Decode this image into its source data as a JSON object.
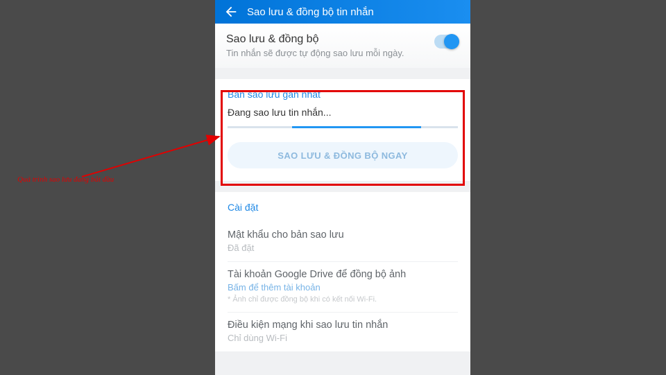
{
  "appbar": {
    "title": "Sao lưu & đồng bộ tin nhắn"
  },
  "sync_card": {
    "title": "Sao lưu & đồng bộ",
    "subtitle": "Tin nhắn sẽ được tự động sao lưu mỗi ngày."
  },
  "recent": {
    "heading": "Bản sao lưu gần nhất",
    "status": "Đang sao lưu tin nhắn...",
    "button": "SAO LƯU & ĐỒNG BỘ NGAY"
  },
  "settings": {
    "heading": "Cài đặt",
    "items": [
      {
        "label": "Mật khẩu cho bản sao lưu",
        "value": "Đã đặt",
        "link": false,
        "note": ""
      },
      {
        "label": "Tài khoản Google Drive để đồng bộ ảnh",
        "value": "Bấm để thêm tài khoản",
        "link": true,
        "note": "* Ảnh chỉ được đồng bộ khi có kết nối Wi-Fi."
      },
      {
        "label": "Điều kiện mạng khi sao lưu tin nhắn",
        "value": "Chỉ dùng Wi-Fi",
        "link": false,
        "note": ""
      }
    ]
  },
  "annotation": {
    "text": "Quá trình sao lưu đang bắt đầu"
  }
}
